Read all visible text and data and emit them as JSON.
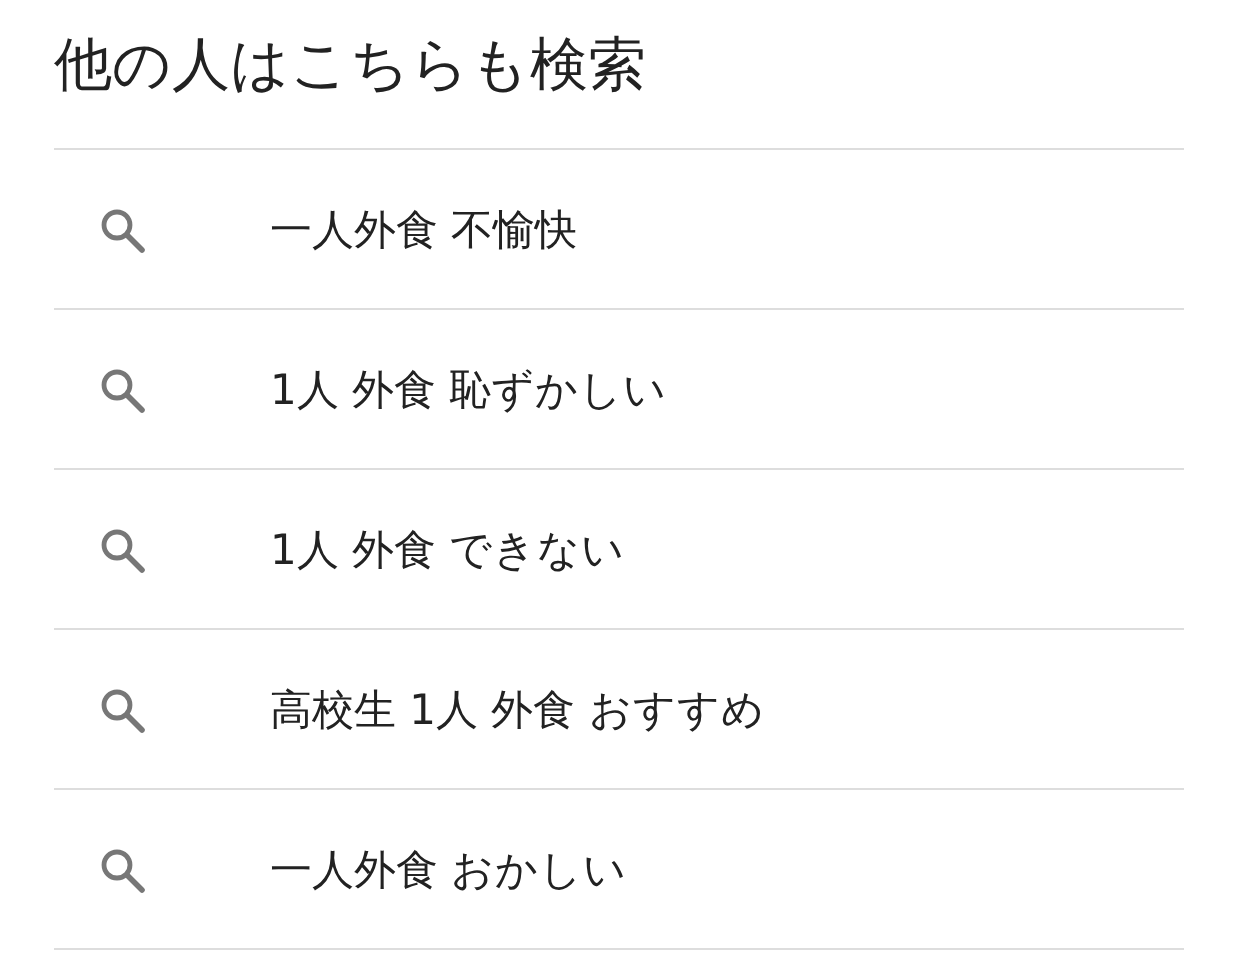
{
  "title": "他の人はこちらも検索",
  "suggestions": [
    {
      "text": "一人外食 不愉快"
    },
    {
      "text": "1人 外食 恥ずかしい"
    },
    {
      "text": "1人 外食 できない"
    },
    {
      "text": "高校生 1人 外食 おすすめ"
    },
    {
      "text": "一人外食 おかしい"
    }
  ]
}
